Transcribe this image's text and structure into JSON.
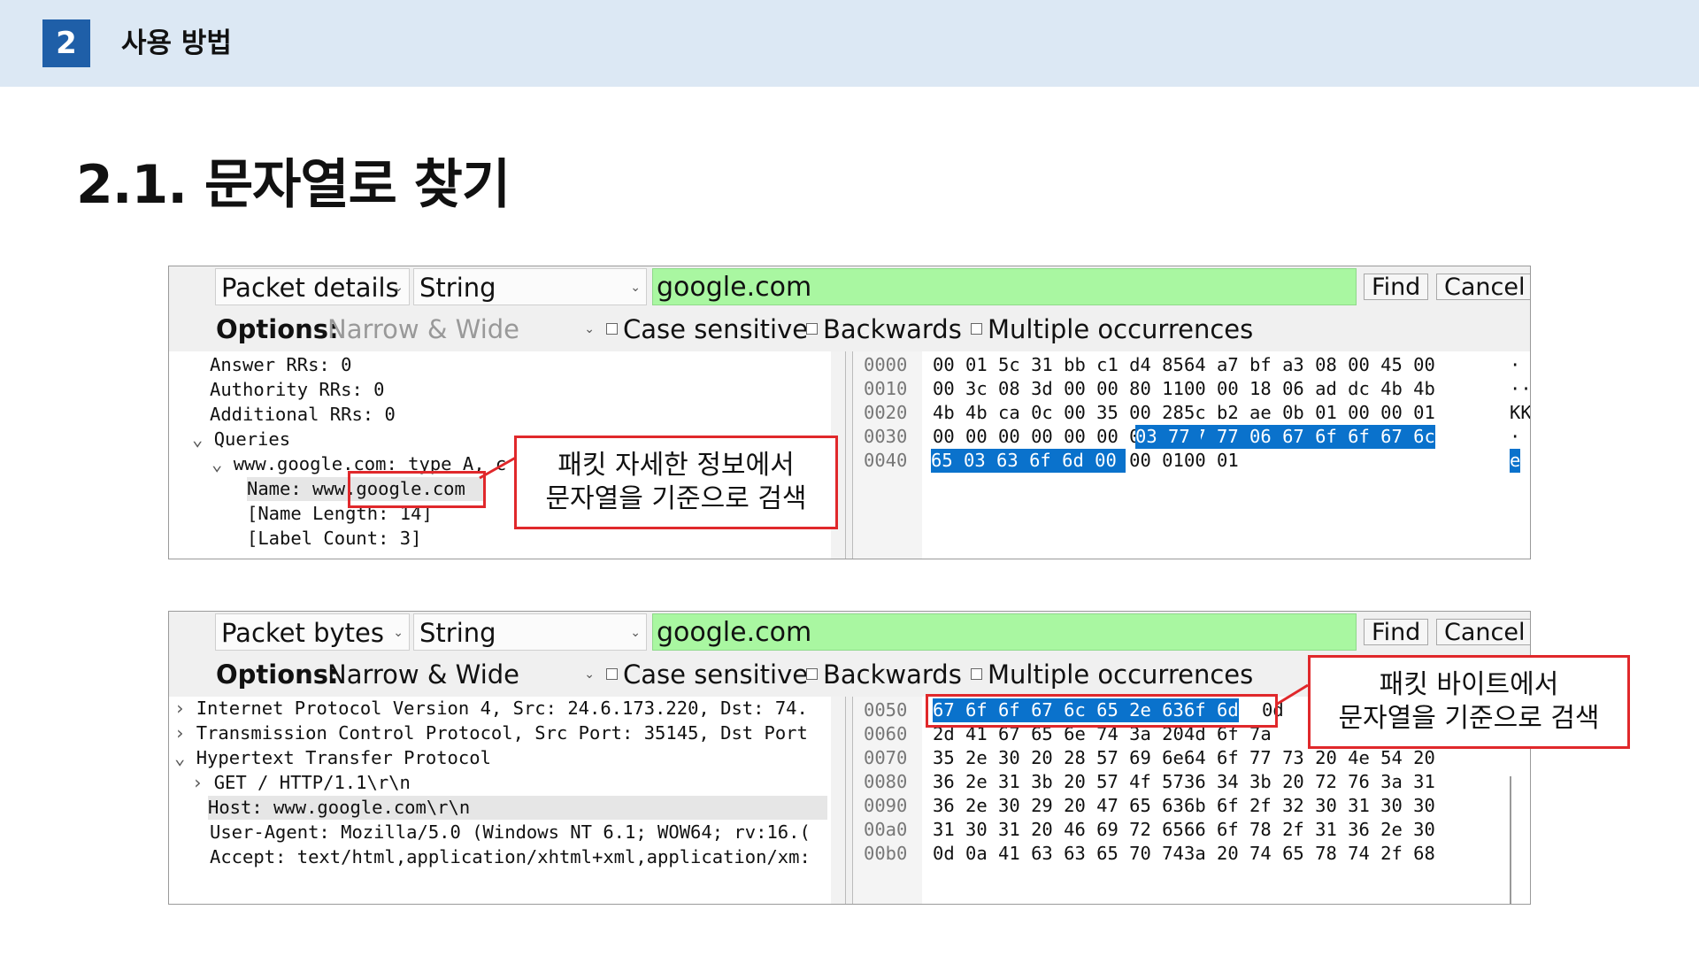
{
  "header": {
    "section_number": "2",
    "section_title": "사용 방법"
  },
  "slide_title": "2.1. 문자열로 찾기",
  "panel1": {
    "scope": "Packet details",
    "type": "String",
    "search_value": "google.com",
    "find_label": "Find",
    "cancel_label": "Cancel",
    "options_label": "Options:",
    "charset": "Narrow & Wide",
    "case_sensitive": "Case sensitive",
    "backwards": "Backwards",
    "multiple": "Multiple occurrences",
    "tree": [
      "Answer RRs: 0",
      "Authority RRs: 0",
      "Additional RRs: 0",
      "Queries",
      "www.google.com: type A, c",
      "Name: www.google.com",
      "[Name Length: 14]",
      "[Label Count: 3]"
    ],
    "hex_offsets": [
      "0000",
      "0010",
      "0020",
      "0030",
      "0040"
    ],
    "hex_rows": [
      [
        "00 01 5c 31 bb c1 d4 85",
        "64 a7 bf a3 08 00 45 00"
      ],
      [
        "00 3c 08 3d 00 00 80 11",
        "00 00 18 06 ad dc 4b 4b"
      ],
      [
        "4b 4b ca 0c 00 35 00 28",
        "5c b2 ae 0b 01 00 00 01"
      ],
      [
        "00 00 00 00 00 00 03 77",
        "77 77 06 67 6f 6f 67 6c"
      ],
      [
        "65 03 63 6f 6d 00 00 01",
        "00 01"
      ]
    ],
    "ascii": [
      "·",
      "··",
      "KK",
      "·",
      "e"
    ],
    "callout": [
      "패킷 자세한 정보에서",
      "문자열을 기준으로 검색"
    ]
  },
  "panel2": {
    "scope": "Packet bytes",
    "type": "String",
    "search_value": "google.com",
    "find_label": "Find",
    "cancel_label": "Cancel",
    "options_label": "Options:",
    "charset": "Narrow & Wide",
    "case_sensitive": "Case sensitive",
    "backwards": "Backwards",
    "multiple": "Multiple occurrences",
    "tree": [
      "Internet Protocol Version 4, Src: 24.6.173.220, Dst: 74.",
      "Transmission Control Protocol, Src Port: 35145, Dst Port",
      "Hypertext Transfer Protocol",
      "GET / HTTP/1.1\\r\\n",
      "Host: www.google.com\\r\\n",
      "User-Agent: Mozilla/5.0 (Windows NT 6.1; WOW64; rv:16.(",
      "Accept: text/html,application/xhtml+xml,application/xm:"
    ],
    "hex_offsets": [
      "0050",
      "0060",
      "0070",
      "0080",
      "0090",
      "00a0",
      "00b0"
    ],
    "hex_rows": [
      [
        "67 6f 6f 67 6c 65 2e 63",
        "6f 6d",
        "0d"
      ],
      [
        "2d 41 67 65 6e 74 3a 20",
        "4d 6f 7a"
      ],
      [
        "35 2e 30 20 28 57 69 6e",
        "64 6f 77 73 20 4e 54 20"
      ],
      [
        "36 2e 31 3b 20 57 4f 57",
        "36 34 3b 20 72 76 3a 31"
      ],
      [
        "36 2e 30 29 20 47 65 63",
        "6b 6f 2f 32 30 31 30 30"
      ],
      [
        "31 30 31 20 46 69 72 65",
        "66 6f 78 2f 31 36 2e 30"
      ],
      [
        "0d 0a 41 63 63 65 70 74",
        "3a 20 74 65 78 74 2f 68"
      ]
    ],
    "callout": [
      "패킷 바이트에서",
      "문자열을 기준으로 검색"
    ]
  },
  "colors": {
    "accent": "#1f5fa8",
    "search_bg": "#a9f7a1",
    "selection": "#0a72cc",
    "callout_border": "#e0282b",
    "header_bg": "#dce8f4"
  }
}
